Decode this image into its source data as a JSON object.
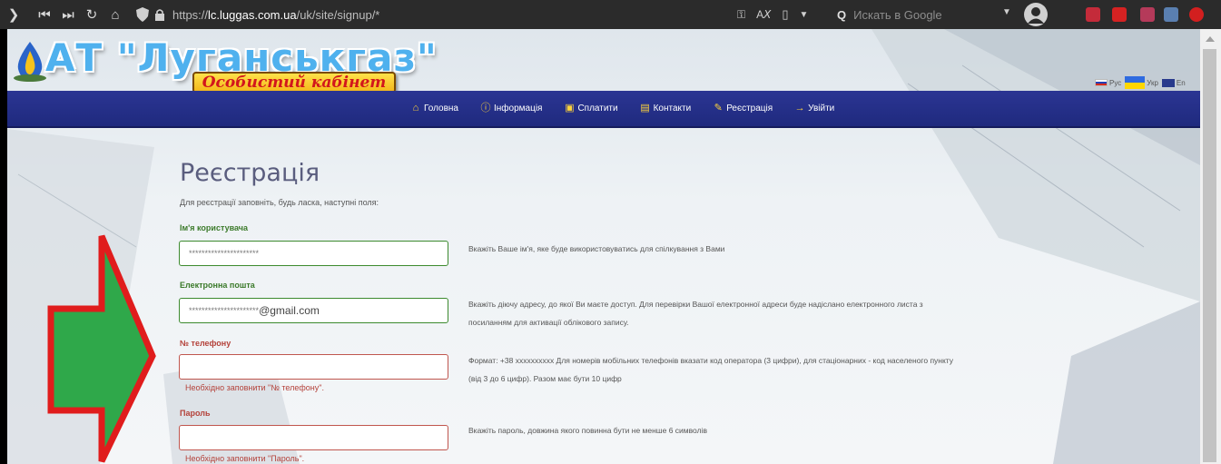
{
  "browser": {
    "url_prefix": "https://",
    "url_host": "lc.luggas.com.ua",
    "url_path": "/uk/site/signup/*",
    "search_placeholder": "Искать в Google"
  },
  "header": {
    "logo_title": "АТ \"Луганськгаз\"",
    "cabinet_label": "Особистий кабінет",
    "languages": [
      {
        "code": "ru",
        "label": "Рус"
      },
      {
        "code": "ua",
        "label": "Укр"
      },
      {
        "code": "en",
        "label": "En"
      }
    ]
  },
  "nav": {
    "items": [
      {
        "label": "Головна",
        "icon": "home-icon"
      },
      {
        "label": "Інформація",
        "icon": "info-icon"
      },
      {
        "label": "Сплатити",
        "icon": "money-icon"
      },
      {
        "label": "Контакти",
        "icon": "contacts-icon"
      },
      {
        "label": "Реєстрація",
        "icon": "pencil-icon"
      },
      {
        "label": "Увійти",
        "icon": "login-icon"
      }
    ]
  },
  "form": {
    "title": "Реєстрація",
    "intro": "Для реєстрації заповніть, будь ласка, наступні поля:",
    "username": {
      "label": "Ім'я користувача",
      "value": "**********************",
      "hint": "Вкажіть Ваше ім'я, яке буде використовуватись для спілкування з Вами"
    },
    "email": {
      "label": "Електронна пошта",
      "value_masked": "**********************",
      "value_domain": "@gmail.com",
      "hint_line1": "Вкажіть діючу адресу, до якої Ви маєте доступ. Для перевірки Вашої електронної адреси буде надіслано електронного листа з",
      "hint_line2": "посиланням для активації облікового запису."
    },
    "phone": {
      "label": "№ телефону",
      "value": "",
      "error": "Необхідно заповнити \"№ телефону\".",
      "hint_line1": "Формат: +38 xxxxxxxxxx Для номерів мобільних телефонів вказати код оператора (3 цифри), для стаціонарних - код населеного пункту",
      "hint_line2": "(від 3 до 6 цифр). Разом має бути 10 цифр"
    },
    "password": {
      "label": "Пароль",
      "value": "",
      "error": "Необхідно заповнити \"Пароль\".",
      "hint": "Вкажіть пароль, довжина якого повинна бути не менше 6 символів"
    }
  },
  "colors": {
    "navbar": "#1f2a7e",
    "valid_border": "#3c8a2e",
    "error_border": "#c0564e",
    "arrow_fill": "#2fa84a",
    "arrow_stroke": "#e01c1c"
  }
}
